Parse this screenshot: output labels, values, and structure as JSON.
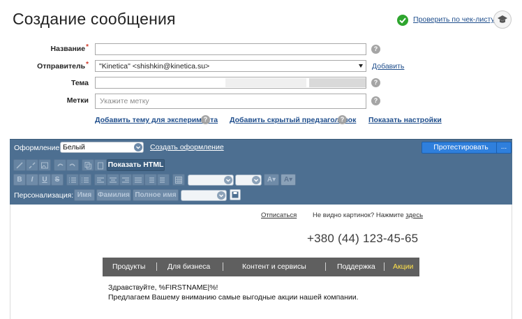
{
  "page": {
    "title": "Создание сообщения"
  },
  "header": {
    "checklist_link": "Проверить по чек-листу"
  },
  "form": {
    "name_label": "Название",
    "sender_label": "Отправитель",
    "sender_value": "\"Kinetica\" <shishkin@kinetica.su>",
    "sender_add": "Добавить",
    "theme_label": "Тема",
    "tags_label": "Метки",
    "tags_placeholder": "Укажите метку",
    "link_experiment": "Добавить тему для эксперимента",
    "link_preheader": "Добавить скрытый предзаголовок",
    "link_settings": "Показать настройки",
    "help_glyph": "?"
  },
  "editor": {
    "design_label": "Оформление:",
    "design_value": "Белый",
    "create_design": "Создать оформление",
    "test_button": "Протестировать",
    "more_button": "...",
    "show_html": "Показать HTML",
    "personalization_label": "Персонализация:",
    "personalization_buttons": [
      "Имя",
      "Фамилия",
      "Полное имя"
    ]
  },
  "preview": {
    "unsubscribe": "Отписаться",
    "no_images": "Не видно картинок? Нажмите",
    "no_images_link": "здесь",
    "phone": "+380 (44) 123-45-65",
    "nav": [
      "Продукты",
      "Для бизнеса",
      "Контент и сервисы",
      "Поддержка",
      "Акции"
    ],
    "greeting": "Здравствуйте, %FIRSTNAME|%!",
    "offer": "Предлагаем Вашему вниманию самые выгодные акции нашей компании."
  },
  "colors": {
    "panel": "#4d6f91",
    "accent_button": "#2f7fdc",
    "link": "#1f4e8c",
    "required": "#d03a2a",
    "ok": "#2ea52e",
    "nav_bg": "#5f5f5f",
    "nav_highlight": "#ffe14a"
  },
  "icons": [
    "check-circle-icon",
    "graduation-cap-icon",
    "help-icon",
    "chevron-down-icon",
    "save-icon"
  ]
}
